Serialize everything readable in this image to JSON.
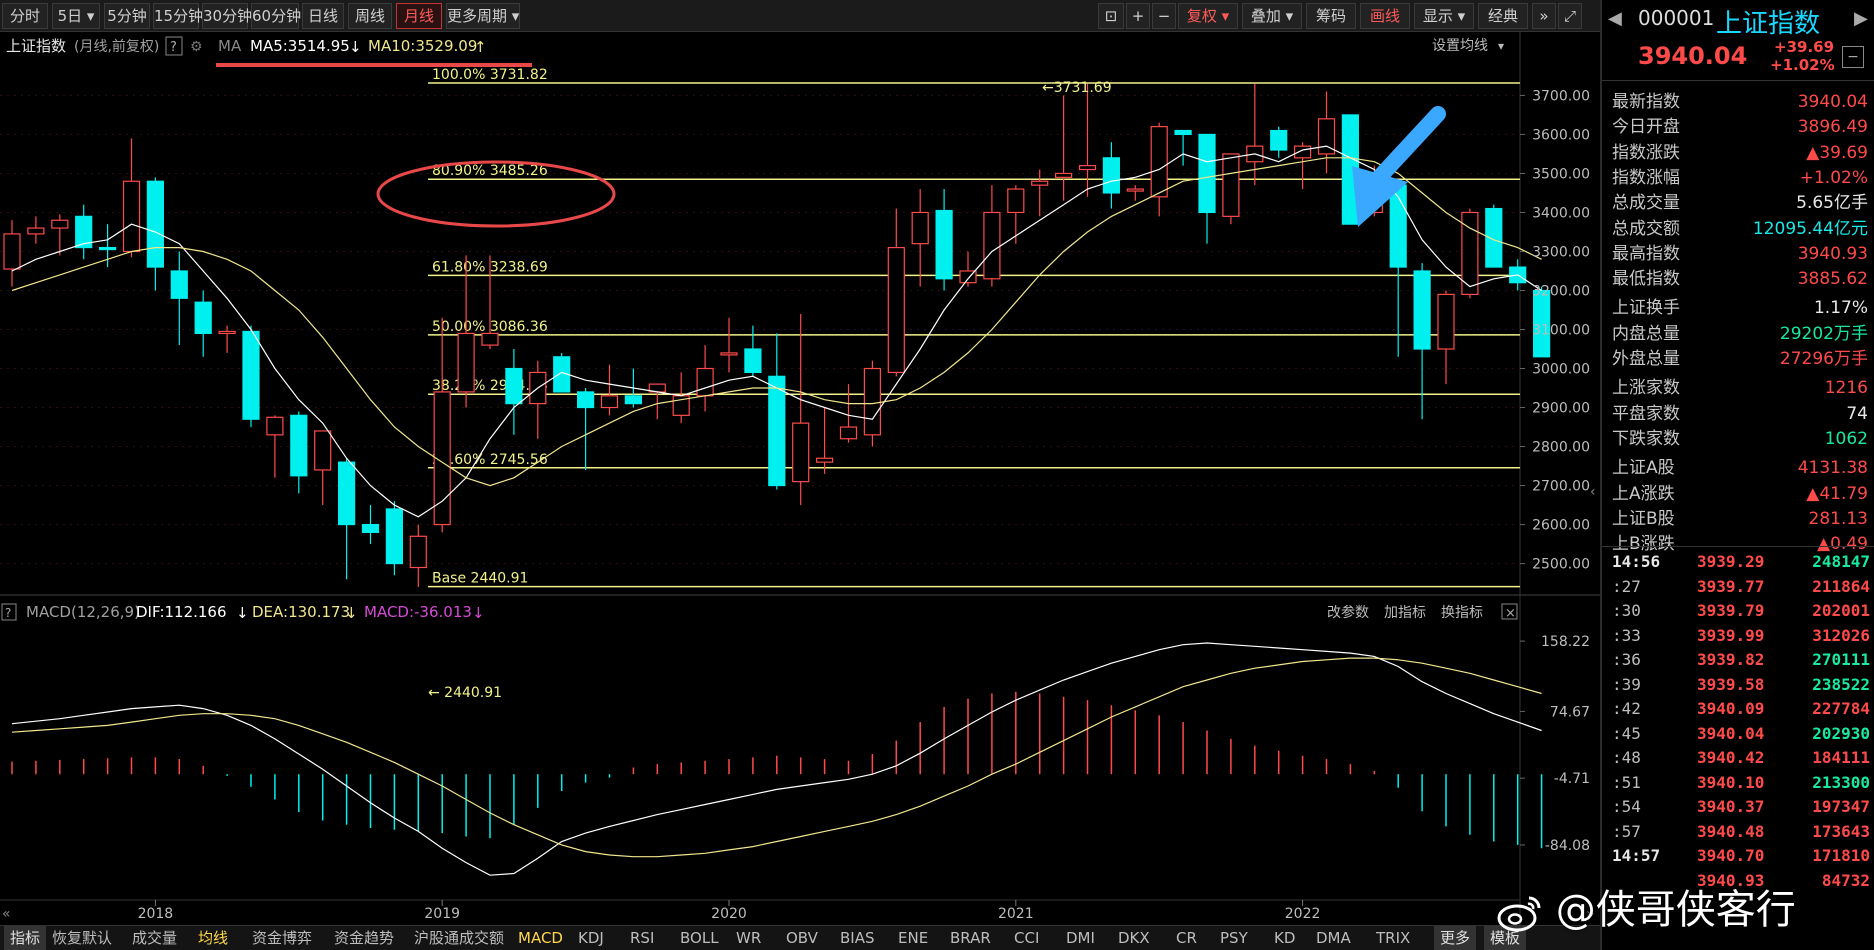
{
  "toolbar": {
    "periods": [
      "分时",
      "5日",
      "5分钟",
      "15分钟",
      "30分钟",
      "60分钟",
      "日线",
      "周线",
      "月线",
      "更多周期"
    ],
    "active_period": "月线",
    "tools": [
      "复权",
      "叠加",
      "筹码",
      "画线",
      "显示",
      "经典"
    ]
  },
  "chart_header": {
    "title": "上证指数",
    "subtitle": "(月线,前复权)",
    "help": "?",
    "ma_label": "MA",
    "ma5": "MA5:3514.95",
    "ma10": "MA10:3529.09",
    "settings": "设置均线"
  },
  "colors": {
    "up": "#ff4a4a",
    "down": "#00f0f0",
    "fib": "#f2f28a",
    "ma5": "#ffffff",
    "ma10": "#f0e68c",
    "macd_purple": "#d84ad8",
    "annotation": "#e84848",
    "arrow": "#3aa8ff"
  },
  "chart_data": {
    "type": "candlestick",
    "title": "上证指数 (月线,前复权)",
    "x_ticks": [
      "2018",
      "2019",
      "2020",
      "2021",
      "2022"
    ],
    "ylim": [
      2440,
      3760
    ],
    "y_ticks": [
      2500,
      2600,
      2700,
      2800,
      2900,
      3000,
      3100,
      3200,
      3300,
      3400,
      3500,
      3600,
      3700
    ],
    "fib_levels": [
      {
        "label": "100.0% 3731.82",
        "value": 3731.82
      },
      {
        "label": "80.90% 3485.26",
        "value": 3485.26
      },
      {
        "label": "61.80% 3238.69",
        "value": 3238.69
      },
      {
        "label": "50.00% 3086.36",
        "value": 3086.36
      },
      {
        "label": "38.20% 2934.04",
        "value": 2934.04
      },
      {
        "label": "23.60% 2745.56",
        "value": 2745.56
      },
      {
        "label": "Base   2440.91",
        "value": 2440.91
      }
    ],
    "high_marker": "←3731.69",
    "low_marker": "← 2440.91",
    "candles": [
      {
        "o": 3255,
        "h": 3380,
        "l": 3210,
        "c": 3345
      },
      {
        "o": 3345,
        "h": 3390,
        "l": 3320,
        "c": 3360
      },
      {
        "o": 3360,
        "h": 3395,
        "l": 3290,
        "c": 3380
      },
      {
        "o": 3390,
        "h": 3420,
        "l": 3280,
        "c": 3310
      },
      {
        "o": 3310,
        "h": 3370,
        "l": 3260,
        "c": 3305
      },
      {
        "o": 3300,
        "h": 3590,
        "l": 3285,
        "c": 3480
      },
      {
        "o": 3480,
        "h": 3490,
        "l": 3200,
        "c": 3260
      },
      {
        "o": 3250,
        "h": 3300,
        "l": 3060,
        "c": 3180
      },
      {
        "o": 3170,
        "h": 3200,
        "l": 3030,
        "c": 3090
      },
      {
        "o": 3090,
        "h": 3110,
        "l": 3040,
        "c": 3095
      },
      {
        "o": 3095,
        "h": 3110,
        "l": 2850,
        "c": 2870
      },
      {
        "o": 2830,
        "h": 2880,
        "l": 2720,
        "c": 2875
      },
      {
        "o": 2880,
        "h": 2890,
        "l": 2680,
        "c": 2725
      },
      {
        "o": 2740,
        "h": 2840,
        "l": 2650,
        "c": 2840
      },
      {
        "o": 2760,
        "h": 2770,
        "l": 2460,
        "c": 2600
      },
      {
        "o": 2600,
        "h": 2650,
        "l": 2550,
        "c": 2580
      },
      {
        "o": 2640,
        "h": 2660,
        "l": 2470,
        "c": 2500
      },
      {
        "o": 2490,
        "h": 2600,
        "l": 2440,
        "c": 2570
      },
      {
        "o": 2600,
        "h": 3130,
        "l": 2580,
        "c": 2940
      },
      {
        "o": 2940,
        "h": 3290,
        "l": 2900,
        "c": 3090
      },
      {
        "o": 3060,
        "h": 3290,
        "l": 3050,
        "c": 3090
      },
      {
        "o": 3000,
        "h": 3050,
        "l": 2830,
        "c": 2910
      },
      {
        "o": 2910,
        "h": 3020,
        "l": 2820,
        "c": 2990
      },
      {
        "o": 3030,
        "h": 3040,
        "l": 2940,
        "c": 2940
      },
      {
        "o": 2940,
        "h": 2950,
        "l": 2740,
        "c": 2900
      },
      {
        "o": 2900,
        "h": 3010,
        "l": 2880,
        "c": 2930
      },
      {
        "o": 2930,
        "h": 3000,
        "l": 2900,
        "c": 2910
      },
      {
        "o": 2940,
        "h": 2960,
        "l": 2870,
        "c": 2960
      },
      {
        "o": 2880,
        "h": 2990,
        "l": 2860,
        "c": 2930
      },
      {
        "o": 2930,
        "h": 3060,
        "l": 2890,
        "c": 3000
      },
      {
        "o": 3040,
        "h": 3130,
        "l": 2990,
        "c": 3040
      },
      {
        "o": 3050,
        "h": 3110,
        "l": 2980,
        "c": 2990
      },
      {
        "o": 2980,
        "h": 3090,
        "l": 2690,
        "c": 2700
      },
      {
        "o": 2710,
        "h": 3140,
        "l": 2650,
        "c": 2860
      },
      {
        "o": 2760,
        "h": 2900,
        "l": 2730,
        "c": 2770
      },
      {
        "o": 2820,
        "h": 2960,
        "l": 2810,
        "c": 2850
      },
      {
        "o": 2830,
        "h": 3020,
        "l": 2800,
        "c": 3000
      },
      {
        "o": 2990,
        "h": 3410,
        "l": 2980,
        "c": 3310
      },
      {
        "o": 3320,
        "h": 3460,
        "l": 3210,
        "c": 3400
      },
      {
        "o": 3405,
        "h": 3460,
        "l": 3200,
        "c": 3230
      },
      {
        "o": 3220,
        "h": 3300,
        "l": 3210,
        "c": 3250
      },
      {
        "o": 3230,
        "h": 3470,
        "l": 3210,
        "c": 3400
      },
      {
        "o": 3400,
        "h": 3470,
        "l": 3320,
        "c": 3460
      },
      {
        "o": 3470,
        "h": 3510,
        "l": 3390,
        "c": 3480
      },
      {
        "o": 3490,
        "h": 3700,
        "l": 3430,
        "c": 3500
      },
      {
        "o": 3510,
        "h": 3730,
        "l": 3440,
        "c": 3520
      },
      {
        "o": 3540,
        "h": 3580,
        "l": 3410,
        "c": 3450
      },
      {
        "o": 3460,
        "h": 3470,
        "l": 3430,
        "c": 3460
      },
      {
        "o": 3440,
        "h": 3630,
        "l": 3390,
        "c": 3620
      },
      {
        "o": 3610,
        "h": 3600,
        "l": 3520,
        "c": 3600
      },
      {
        "o": 3600,
        "h": 3520,
        "l": 3320,
        "c": 3400
      },
      {
        "o": 3390,
        "h": 3540,
        "l": 3370,
        "c": 3550
      },
      {
        "o": 3530,
        "h": 3730,
        "l": 3470,
        "c": 3570
      },
      {
        "o": 3610,
        "h": 3620,
        "l": 3540,
        "c": 3560
      },
      {
        "o": 3540,
        "h": 3580,
        "l": 3460,
        "c": 3570
      },
      {
        "o": 3550,
        "h": 3710,
        "l": 3500,
        "c": 3640
      },
      {
        "o": 3650,
        "h": 3650,
        "l": 3370,
        "c": 3370
      },
      {
        "o": 3400,
        "h": 3520,
        "l": 3390,
        "c": 3460
      },
      {
        "o": 3470,
        "h": 3480,
        "l": 3030,
        "c": 3260
      },
      {
        "o": 3250,
        "h": 3270,
        "l": 2870,
        "c": 3050
      },
      {
        "o": 3050,
        "h": 3200,
        "l": 2960,
        "c": 3190
      },
      {
        "o": 3190,
        "h": 3410,
        "l": 3180,
        "c": 3400
      },
      {
        "o": 3410,
        "h": 3420,
        "l": 3270,
        "c": 3260
      },
      {
        "o": 3260,
        "h": 3280,
        "l": 3200,
        "c": 3220
      },
      {
        "o": 3200,
        "h": 3210,
        "l": 3030,
        "c": 3030
      }
    ],
    "ma5": [
      3250,
      3280,
      3300,
      3320,
      3330,
      3370,
      3350,
      3320,
      3250,
      3180,
      3100,
      3000,
      2920,
      2860,
      2770,
      2700,
      2650,
      2620,
      2660,
      2720,
      2820,
      2900,
      2950,
      2990,
      2970,
      2960,
      2950,
      2940,
      2930,
      2950,
      2970,
      2980,
      2950,
      2920,
      2900,
      2880,
      2870,
      2960,
      3050,
      3150,
      3230,
      3300,
      3340,
      3380,
      3420,
      3460,
      3480,
      3490,
      3510,
      3550,
      3530,
      3540,
      3550,
      3530,
      3560,
      3570,
      3540,
      3510,
      3440,
      3330,
      3260,
      3210,
      3230,
      3240,
      3200
    ],
    "ma10": [
      3200,
      3220,
      3240,
      3260,
      3280,
      3300,
      3310,
      3310,
      3300,
      3280,
      3250,
      3200,
      3150,
      3080,
      3000,
      2920,
      2850,
      2800,
      2760,
      2720,
      2700,
      2720,
      2760,
      2800,
      2830,
      2860,
      2890,
      2910,
      2920,
      2930,
      2940,
      2950,
      2950,
      2940,
      2920,
      2910,
      2910,
      2920,
      2950,
      2990,
      3040,
      3100,
      3170,
      3240,
      3300,
      3350,
      3390,
      3420,
      3450,
      3480,
      3490,
      3500,
      3510,
      3520,
      3530,
      3540,
      3540,
      3530,
      3500,
      3450,
      3400,
      3360,
      3330,
      3310,
      3280
    ],
    "macd_header": {
      "title": "MACD(12,26,9)",
      "dif": "DIF:112.166",
      "dea": "DEA:130.173",
      "macd": "MACD:-36.013",
      "actions": [
        "改参数",
        "加指标",
        "换指标"
      ]
    },
    "macd_y_ticks": [
      "158.22",
      "74.67",
      "-4.71",
      "-84.08"
    ],
    "macd_ylim": [
      -140,
      175
    ],
    "dif": [
      60,
      63,
      66,
      70,
      74,
      78,
      80,
      82,
      78,
      70,
      58,
      42,
      24,
      6,
      -14,
      -34,
      -52,
      -68,
      -88,
      -105,
      -120,
      -118,
      -100,
      -80,
      -70,
      -62,
      -55,
      -48,
      -42,
      -36,
      -30,
      -24,
      -18,
      -14,
      -10,
      -6,
      0,
      10,
      25,
      42,
      58,
      74,
      88,
      100,
      112,
      122,
      132,
      140,
      148,
      154,
      156,
      154,
      152,
      150,
      148,
      146,
      144,
      140,
      128,
      110,
      96,
      84,
      72,
      62,
      52
    ],
    "dea": [
      50,
      52,
      54,
      56,
      58,
      62,
      66,
      70,
      72,
      72,
      70,
      66,
      58,
      48,
      38,
      26,
      14,
      0,
      -14,
      -30,
      -46,
      -60,
      -72,
      -84,
      -92,
      -96,
      -98,
      -98,
      -96,
      -94,
      -90,
      -86,
      -80,
      -74,
      -68,
      -62,
      -56,
      -48,
      -38,
      -26,
      -14,
      0,
      12,
      26,
      40,
      54,
      68,
      80,
      92,
      104,
      112,
      120,
      126,
      130,
      134,
      136,
      138,
      138,
      136,
      132,
      126,
      120,
      112,
      104,
      96
    ],
    "macd_bars": [
      15,
      16,
      17,
      18,
      19,
      20,
      20,
      18,
      10,
      -2,
      -15,
      -30,
      -45,
      -55,
      -60,
      -64,
      -66,
      -68,
      -70,
      -74,
      -76,
      -60,
      -40,
      -20,
      -10,
      -4,
      8,
      12,
      14,
      16,
      18,
      20,
      22,
      20,
      18,
      16,
      24,
      40,
      62,
      80,
      90,
      96,
      98,
      96,
      92,
      88,
      82,
      76,
      70,
      62,
      52,
      42,
      34,
      28,
      22,
      18,
      12,
      4,
      -16,
      -44,
      -62,
      -72,
      -80,
      -84,
      -88
    ]
  },
  "markers": {
    "high_price": "3731.69"
  },
  "bottom_tabs": [
    "指标",
    "恢复默认",
    "成交量",
    "均线",
    "资金博弈",
    "资金趋势",
    "沪股通成交额",
    "MACD",
    "KDJ",
    "RSI",
    "BOLL",
    "WR",
    "OBV",
    "BIAS",
    "ENE",
    "BRAR",
    "CCI",
    "DMI",
    "DKX",
    "CR",
    "PSY",
    "KD",
    "DMA",
    "TRIX",
    "更多",
    "模板"
  ],
  "active_bottom": [
    "均线",
    "MACD"
  ],
  "right_panel": {
    "code": "000001",
    "name": "上证指数",
    "price": "3940.04",
    "change": "+39.69",
    "change_pct": "+1.02%",
    "stats": [
      {
        "label": "最新指数",
        "value": "3940.04",
        "color": "#ff4a4a"
      },
      {
        "label": "今日开盘",
        "value": "3896.49",
        "color": "#ff4a4a"
      },
      {
        "label": "指数涨跌",
        "value": "▲39.69",
        "color": "#ff4a4a"
      },
      {
        "label": "指数涨幅",
        "value": "+1.02%",
        "color": "#ff4a4a"
      },
      {
        "label": "总成交量",
        "value": "5.65亿手",
        "color": "#e8e8e8"
      },
      {
        "label": "总成交额",
        "value": "12095.44亿元",
        "color": "#19e8e8"
      },
      {
        "label": "最高指数",
        "value": "3940.93",
        "color": "#ff4a4a"
      },
      {
        "label": "最低指数",
        "value": "3885.62",
        "color": "#ff4a4a"
      },
      {
        "label": "上证换手",
        "value": "1.17%",
        "color": "#e8e8e8"
      },
      {
        "label": "内盘总量",
        "value": "29202万手",
        "color": "#19e8a0"
      },
      {
        "label": "外盘总量",
        "value": "27296万手",
        "color": "#ff4a4a"
      },
      {
        "label": "上涨家数",
        "value": "1216",
        "color": "#ff4a4a"
      },
      {
        "label": "平盘家数",
        "value": "74",
        "color": "#e8e8e8"
      },
      {
        "label": "下跌家数",
        "value": "1062",
        "color": "#19e8a0"
      },
      {
        "label": "上证A股",
        "value": "4131.38",
        "color": "#ff4a4a"
      },
      {
        "label": "上A涨跌",
        "value": "▲41.79",
        "color": "#ff4a4a"
      },
      {
        "label": "上证B股",
        "value": "281.13",
        "color": "#ff4a4a"
      },
      {
        "label": "上B涨跌",
        "value": "▲0.49",
        "color": "#ff4a4a"
      }
    ],
    "ticks": [
      {
        "time": "14:56",
        "price": "3939.29",
        "vol": "248147",
        "vcolor": "#19e8a0"
      },
      {
        "time": ":27",
        "price": "3939.77",
        "vol": "211864",
        "vcolor": "#ff4a4a"
      },
      {
        "time": ":30",
        "price": "3939.79",
        "vol": "202001",
        "vcolor": "#ff4a4a"
      },
      {
        "time": ":33",
        "price": "3939.99",
        "vol": "312026",
        "vcolor": "#ff4a4a"
      },
      {
        "time": ":36",
        "price": "3939.82",
        "vol": "270111",
        "vcolor": "#19e8a0"
      },
      {
        "time": ":39",
        "price": "3939.58",
        "vol": "238522",
        "vcolor": "#19e8a0"
      },
      {
        "time": ":42",
        "price": "3940.09",
        "vol": "227784",
        "vcolor": "#ff4a4a"
      },
      {
        "time": ":45",
        "price": "3940.04",
        "vol": "202930",
        "vcolor": "#19e8a0"
      },
      {
        "time": ":48",
        "price": "3940.42",
        "vol": "184111",
        "vcolor": "#ff4a4a"
      },
      {
        "time": ":51",
        "price": "3940.10",
        "vol": "213300",
        "vcolor": "#19e8a0"
      },
      {
        "time": ":54",
        "price": "3940.37",
        "vol": "197347",
        "vcolor": "#ff4a4a"
      },
      {
        "time": ":57",
        "price": "3940.48",
        "vol": "173643",
        "vcolor": "#ff4a4a"
      },
      {
        "time": "14:57",
        "price": "3940.70",
        "vol": "171810",
        "vcolor": "#ff4a4a"
      },
      {
        "time": "",
        "price": "3940.93",
        "vol": "84732",
        "vcolor": "#ff4a4a"
      }
    ]
  },
  "watermark": "@侠哥侠客行"
}
